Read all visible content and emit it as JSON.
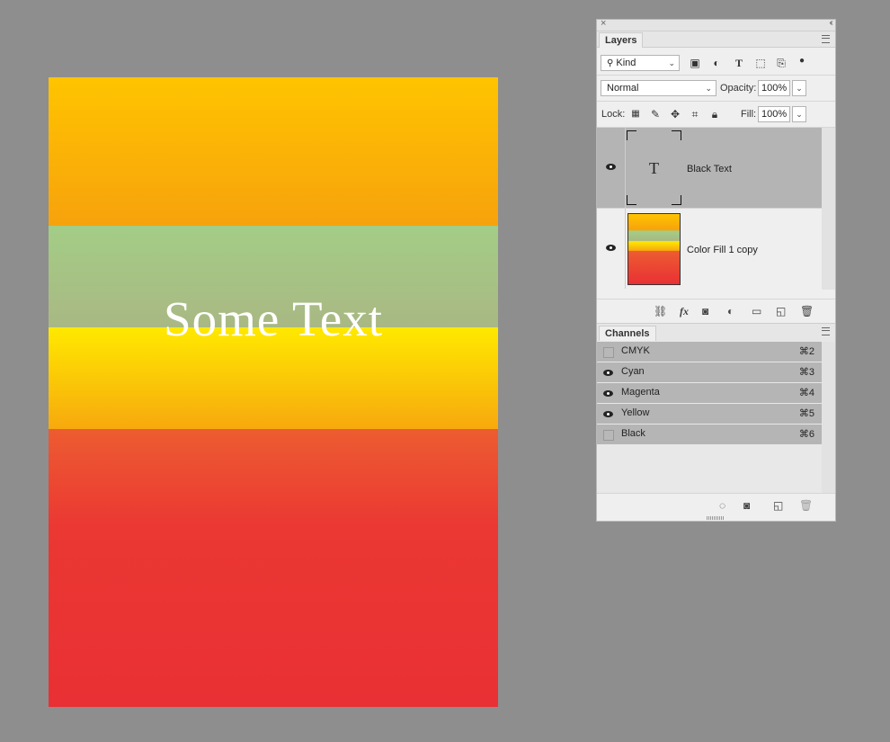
{
  "canvas": {
    "text": "Some Text",
    "colors": {
      "orange": "#ffc400",
      "green": "#a3cd86",
      "yellow": "#ffe900",
      "red": "#e93034"
    }
  },
  "layers_panel": {
    "tab_label": "Layers",
    "filter_kind": "Kind",
    "blend_mode": "Normal",
    "opacity_label": "Opacity:",
    "opacity_value": "100%",
    "lock_label": "Lock:",
    "fill_label": "Fill:",
    "fill_value": "100%",
    "layers": [
      {
        "name": "Black Text",
        "type": "text",
        "visible": true,
        "selected": true,
        "thumb_glyph": "T"
      },
      {
        "name": "Color Fill 1 copy",
        "type": "fill",
        "visible": true,
        "selected": false
      }
    ],
    "footer_icons": [
      "link-icon",
      "fx-icon",
      "mask-icon",
      "adjustment-icon",
      "folder-icon",
      "new-layer-icon",
      "trash-icon"
    ],
    "fx_label": "fx"
  },
  "channels_panel": {
    "tab_label": "Channels",
    "channels": [
      {
        "name": "CMYK",
        "shortcut": "⌘2",
        "visible": false
      },
      {
        "name": "Cyan",
        "shortcut": "⌘3",
        "visible": true
      },
      {
        "name": "Magenta",
        "shortcut": "⌘4",
        "visible": true
      },
      {
        "name": "Yellow",
        "shortcut": "⌘5",
        "visible": true
      },
      {
        "name": "Black",
        "shortcut": "⌘6",
        "visible": false
      }
    ]
  }
}
